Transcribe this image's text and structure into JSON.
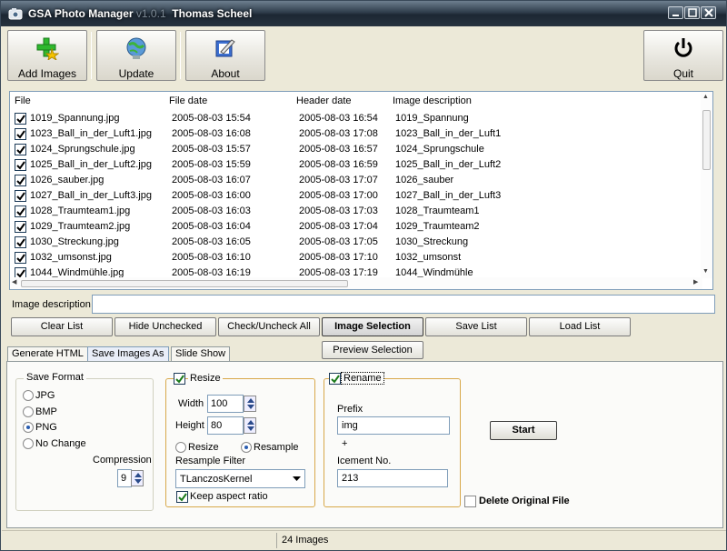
{
  "window": {
    "title": "GSA Photo Manager",
    "version": "v1.0.1",
    "author": "Thomas Scheel"
  },
  "toolbar": {
    "add_images": "Add Images",
    "update": "Update",
    "about": "About",
    "quit": "Quit"
  },
  "list": {
    "columns": [
      "File",
      "File date",
      "Header date",
      "Image description"
    ],
    "rows": [
      {
        "checked": true,
        "file": "1019_Spannung.jpg",
        "file_date": "2005-08-03 15:54",
        "header_date": "2005-08-03 16:54",
        "description": "1019_Spannung"
      },
      {
        "checked": true,
        "file": "1023_Ball_in_der_Luft1.jpg",
        "file_date": "2005-08-03 16:08",
        "header_date": "2005-08-03 17:08",
        "description": "1023_Ball_in_der_Luft1"
      },
      {
        "checked": true,
        "file": "1024_Sprungschule.jpg",
        "file_date": "2005-08-03 15:57",
        "header_date": "2005-08-03 16:57",
        "description": "1024_Sprungschule"
      },
      {
        "checked": true,
        "file": "1025_Ball_in_der_Luft2.jpg",
        "file_date": "2005-08-03 15:59",
        "header_date": "2005-08-03 16:59",
        "description": "1025_Ball_in_der_Luft2"
      },
      {
        "checked": true,
        "file": "1026_sauber.jpg",
        "file_date": "2005-08-03 16:07",
        "header_date": "2005-08-03 17:07",
        "description": "1026_sauber"
      },
      {
        "checked": true,
        "file": "1027_Ball_in_der_Luft3.jpg",
        "file_date": "2005-08-03 16:00",
        "header_date": "2005-08-03 17:00",
        "description": "1027_Ball_in_der_Luft3"
      },
      {
        "checked": true,
        "file": "1028_Traumteam1.jpg",
        "file_date": "2005-08-03 16:03",
        "header_date": "2005-08-03 17:03",
        "description": "1028_Traumteam1"
      },
      {
        "checked": true,
        "file": "1029_Traumteam2.jpg",
        "file_date": "2005-08-03 16:04",
        "header_date": "2005-08-03 17:04",
        "description": "1029_Traumteam2"
      },
      {
        "checked": true,
        "file": "1030_Streckung.jpg",
        "file_date": "2005-08-03 16:05",
        "header_date": "2005-08-03 17:05",
        "description": "1030_Streckung"
      },
      {
        "checked": true,
        "file": "1032_umsonst.jpg",
        "file_date": "2005-08-03 16:10",
        "header_date": "2005-08-03 17:10",
        "description": "1032_umsonst"
      },
      {
        "checked": true,
        "file": "1044_Windmühle.jpg",
        "file_date": "2005-08-03 16:19",
        "header_date": "2005-08-03 17:19",
        "description": "1044_Windmühle"
      }
    ]
  },
  "image_description": {
    "label": "Image description",
    "value": ""
  },
  "actions": {
    "clear_list": "Clear List",
    "hide_unchecked": "Hide Unchecked",
    "check_uncheck_all": "Check/Uncheck All",
    "image_selection": "Image Selection",
    "save_list": "Save List",
    "load_list": "Load List"
  },
  "tabs": [
    {
      "label": "Generate HTML",
      "active": false
    },
    {
      "label": "Save Images  As",
      "active": true
    },
    {
      "label": "Slide Show",
      "active": false
    }
  ],
  "preview_selection": "Preview Selection",
  "save_format": {
    "legend": "Save Format",
    "options": [
      "JPG",
      "BMP",
      "PNG",
      "No Change"
    ],
    "selected": "PNG",
    "compression_label": "Compression",
    "compression_value": "9"
  },
  "resize": {
    "legend": "Resize",
    "checked": true,
    "width_label": "Width",
    "width_value": "100",
    "height_label": "Height",
    "height_value": "80",
    "mode_resize": "Resize",
    "mode_resample": "Resample",
    "selected_mode": "Resample",
    "filter_label": "Resample Filter",
    "filter_value": "TLanczosKernel",
    "keep_aspect_label": "Keep aspect ratio",
    "keep_aspect": true
  },
  "rename": {
    "legend": "Rename",
    "checked": true,
    "prefix_label": "Prefix",
    "prefix_value": "img",
    "plus": "+",
    "increment_label": "Icement No.",
    "increment_value": "213"
  },
  "start": "Start",
  "delete_original": {
    "label": "Delete Original File",
    "checked": false
  },
  "status": {
    "text": "24 Images"
  }
}
